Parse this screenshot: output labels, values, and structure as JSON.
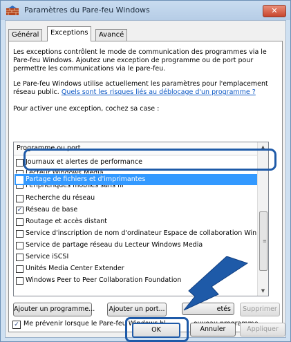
{
  "window": {
    "title": "Paramètres du Pare-feu Windows"
  },
  "tabs": [
    {
      "label": "Général",
      "active": false
    },
    {
      "label": "Exceptions",
      "active": true
    },
    {
      "label": "Avancé",
      "active": false
    }
  ],
  "body": {
    "intro": "Les exceptions contrôlent le mode de communication des programmes via le Pare-feu Windows. Ajoutez une exception de programme ou de port pour permettre les communications via le pare-feu.",
    "network_text": "Le Pare-feu Windows utilise actuellement les paramètres pour l'emplacement réseau public.",
    "network_link": "Quels sont les risques liés au déblocage d'un programme ?",
    "instruction": "Pour activer une exception, cochez sa case :"
  },
  "list": {
    "header": "Programme ou port",
    "rows": [
      {
        "label": "Journaux et alertes de performance",
        "checked": false,
        "selected": false
      },
      {
        "label": "Lecteur Windows Media",
        "checked": false,
        "selected": false
      },
      {
        "label": "Partage de fichiers et d'imprimantes",
        "checked": false,
        "selected": true
      },
      {
        "label": "Périphériques mobiles sans fil",
        "checked": false,
        "selected": false
      },
      {
        "label": "Recherche du réseau",
        "checked": false,
        "selected": false
      },
      {
        "label": "Réseau de base",
        "checked": true,
        "selected": false
      },
      {
        "label": "Routage et accès distant",
        "checked": false,
        "selected": false
      },
      {
        "label": "Service d'inscription de nom d'ordinateur Espace de collaboration Win...",
        "checked": false,
        "selected": false
      },
      {
        "label": "Service de partage réseau du Lecteur Windows Media",
        "checked": false,
        "selected": false
      },
      {
        "label": "Service iSCSI",
        "checked": false,
        "selected": false
      },
      {
        "label": "Unités Media Center Extender",
        "checked": false,
        "selected": false
      },
      {
        "label": "Windows Peer to Peer Collaboration Foundation",
        "checked": false,
        "selected": false
      }
    ]
  },
  "buttons": {
    "add_program": "Ajouter un programme...",
    "add_port": "Ajouter un port...",
    "properties": "etés",
    "delete": "Supprimer",
    "ok": "OK",
    "cancel": "Annuler",
    "apply": "Appliquer"
  },
  "notify": {
    "checked": true,
    "label_start": "Me prévenir lorsque le Pare-feu Windows bl",
    "label_end": "ouveau programme"
  },
  "icons": {
    "app": "firewall-brick-icon",
    "close": "close-icon",
    "pointer": "arrow-pointer-icon"
  },
  "colors": {
    "selection": "#3399ff",
    "highlight_outline": "#1e5aa8",
    "link": "#0b57c4"
  }
}
